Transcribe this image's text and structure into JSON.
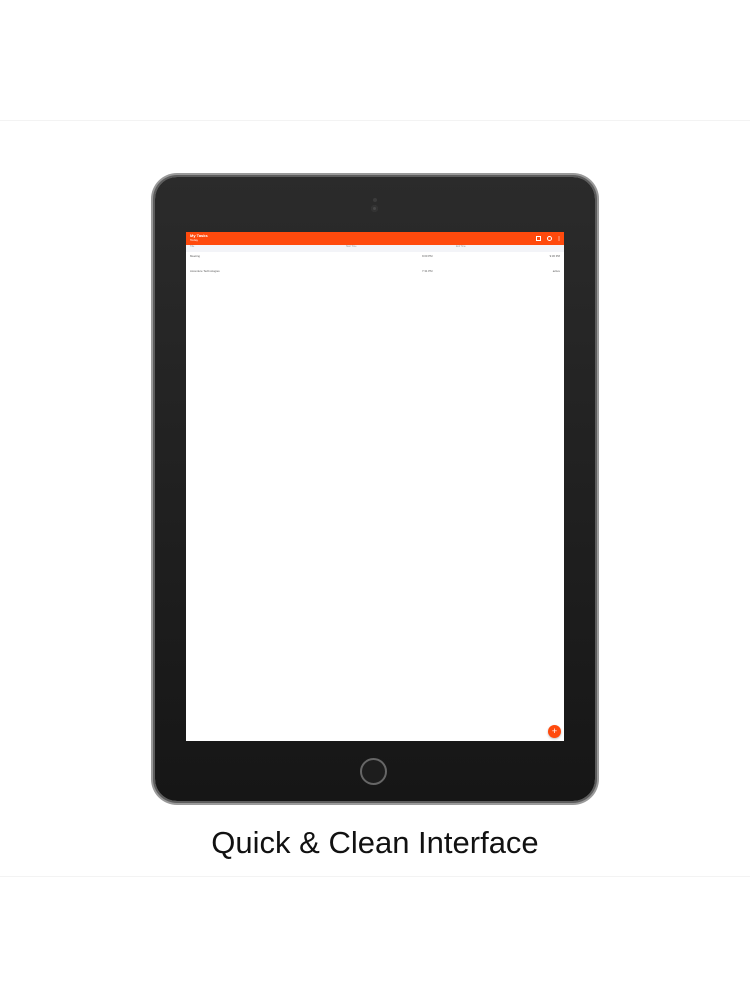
{
  "colors": {
    "accent": "#ff4a0d",
    "screen_background": "#ffffff",
    "device_frame": "#1b1b1b"
  },
  "app": {
    "title": "My Tasks",
    "subtitle": "Today",
    "actions": [
      {
        "icon": "calendar-icon"
      },
      {
        "icon": "gear-icon"
      },
      {
        "icon": "more-vertical-icon"
      }
    ]
  },
  "table": {
    "columns": [
      "Title",
      "Start Time",
      "End Time"
    ],
    "rows": [
      {
        "title": "Meeting",
        "start": "9:00 PM",
        "end": "9:30 PM"
      },
      {
        "title": "Accenture Technologies",
        "start": "7:31 PM",
        "end": "active"
      }
    ]
  },
  "fab": {
    "label": "+"
  },
  "caption": "Quick & Clean Interface"
}
